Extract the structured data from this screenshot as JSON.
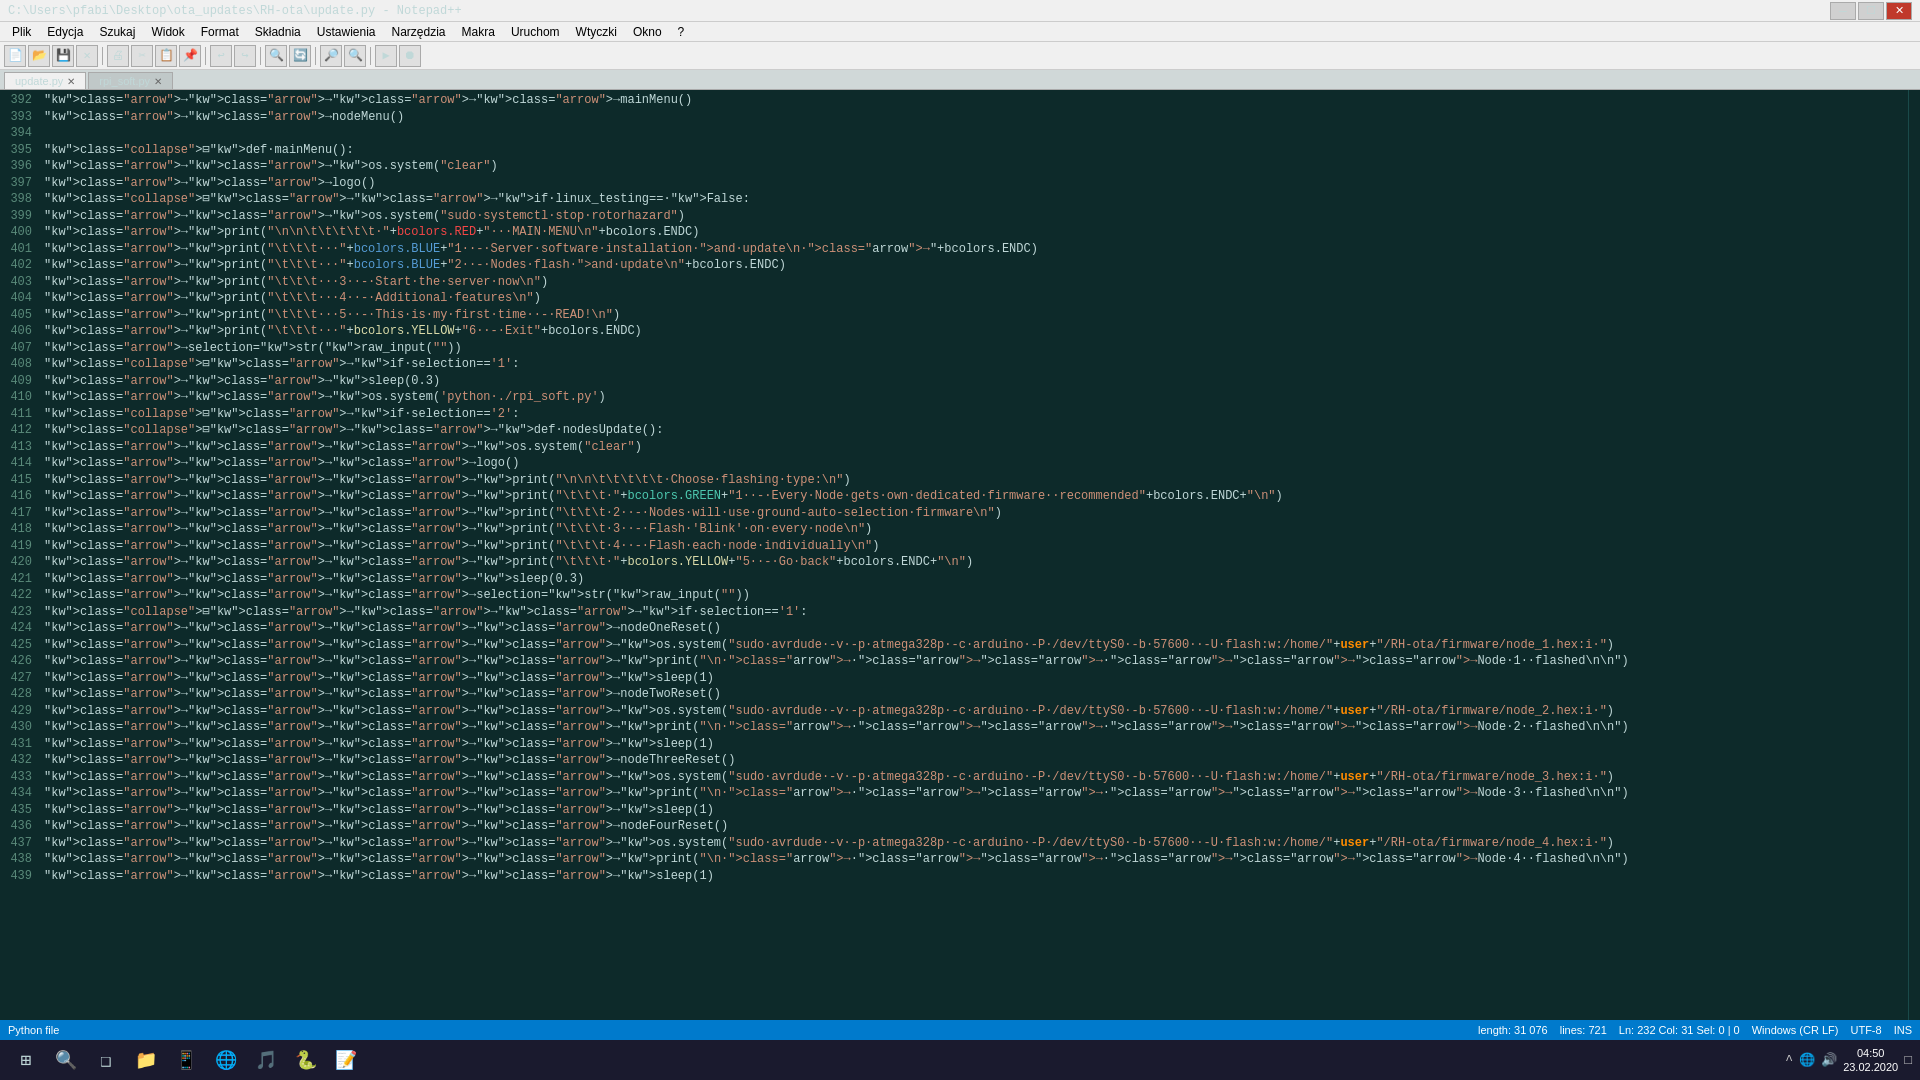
{
  "titleBar": {
    "title": "C:\\Users\\pfabi\\Desktop\\ota_updates\\RH-ota\\update.py - Notepad++",
    "minimize": "─",
    "restore": "☐",
    "close": "✕"
  },
  "menuBar": {
    "items": [
      "Plik",
      "Edycja",
      "Szukaj",
      "Widok",
      "Format",
      "Składnia",
      "Ustawienia",
      "Narzędzia",
      "Makra",
      "Uruchom",
      "Wtyczki",
      "Okno",
      "?"
    ]
  },
  "tabs": [
    {
      "label": "update.py",
      "active": true
    },
    {
      "label": "rpi_soft.py",
      "active": false
    }
  ],
  "statusBar": {
    "filetype": "Python file",
    "length": "length: 31 076",
    "lines": "lines: 721",
    "position": "Ln: 232   Col: 31   Sel: 0 | 0",
    "lineEnding": "Windows (CR LF)",
    "encoding": "UTF-8",
    "insertMode": "INS"
  },
  "taskbar": {
    "clock": "04:50",
    "date": "23.02.2020"
  },
  "code": {
    "startLine": 392,
    "lines": [
      {
        "num": 392,
        "text": "    →→→→mainMenu()"
      },
      {
        "num": 393,
        "text": "    →→nodeMenu()"
      },
      {
        "num": 394,
        "text": ""
      },
      {
        "num": 395,
        "text": "⊟def·mainMenu():"
      },
      {
        "num": 396,
        "text": "    →→os.system(\"clear\")"
      },
      {
        "num": 397,
        "text": "    →→logo()"
      },
      {
        "num": 398,
        "text": "⊟   →→if·linux_testing==·False:"
      },
      {
        "num": 399,
        "text": "        →→os.system(\"sudo·systemctl·stop·rotorhazard\")"
      },
      {
        "num": 400,
        "text": "    →print(\"\\n\\n\\t\\t\\t\\t\\t·\"+bcolors.RED+\"···MAIN·MENU\\n\"+bcolors.ENDC)"
      },
      {
        "num": 401,
        "text": "    →print(\"\\t\\t\\t···\"+bcolors.BLUE+\"1··-·Server·software·installation·and·update\\n·→\"+bcolors.ENDC)"
      },
      {
        "num": 402,
        "text": "    →print(\"\\t\\t\\t···\"+bcolors.BLUE+\"2··-·Nodes·flash·and·update\\n\"+bcolors.ENDC)"
      },
      {
        "num": 403,
        "text": "    →print(\"\\t\\t\\t···3··-·Start·the·server·now\\n\")"
      },
      {
        "num": 404,
        "text": "    →print(\"\\t\\t\\t···4··-·Additional·features\\n\")"
      },
      {
        "num": 405,
        "text": "    →print(\"\\t\\t\\t···5··-·This·is·my·first·time··-·READ!\\n\")"
      },
      {
        "num": 406,
        "text": "    →print(\"\\t\\t\\t···\"+bcolors.YELLOW+\"6··-·Exit\"+bcolors.ENDC)"
      },
      {
        "num": 407,
        "text": "    →selection=str(raw_input(\"\"))"
      },
      {
        "num": 408,
        "text": "⊟   →if·selection=='1':"
      },
      {
        "num": 409,
        "text": "        →→sleep(0.3)"
      },
      {
        "num": 410,
        "text": "        →→os.system('python·./rpi_soft.py')"
      },
      {
        "num": 411,
        "text": "⊟   →if·selection=='2':"
      },
      {
        "num": 412,
        "text": "⊟       →→def·nodesUpdate():"
      },
      {
        "num": 413,
        "text": "            →→→os.system(\"clear\")"
      },
      {
        "num": 414,
        "text": "            →→→logo()"
      },
      {
        "num": 415,
        "text": "            →→→print(\"\\n\\n\\t\\t\\t\\t\\t·Choose·flashing·type:\\n\")"
      },
      {
        "num": 416,
        "text": "            →→→print(\"\\t\\t\\t·\"+bcolors.GREEN+\"1··-·Every·Node·gets·own·dedicated·firmware··recommended\"+bcolors.ENDC+\"\\n\")"
      },
      {
        "num": 417,
        "text": "            →→→print(\"\\t\\t\\t·2··-·Nodes·will·use·ground-auto-selection·firmware\\n\")"
      },
      {
        "num": 418,
        "text": "            →→→print(\"\\t\\t\\t·3··-·Flash·'Blink'·on·every·node\\n\")"
      },
      {
        "num": 419,
        "text": "            →→→print(\"\\t\\t\\t·4··-·Flash·each·node·individually\\n\")"
      },
      {
        "num": 420,
        "text": "            →→→print(\"\\t\\t\\t·\"+bcolors.YELLOW+\"5··-·Go·back\"+bcolors.ENDC+\"\\n\")"
      },
      {
        "num": 421,
        "text": "            →→→sleep(0.3)"
      },
      {
        "num": 422,
        "text": "            →→→selection=str(raw_input(\"\"))"
      },
      {
        "num": 423,
        "text": "⊟           →→→if·selection=='1':"
      },
      {
        "num": 424,
        "text": "                →→→→nodeOneReset()"
      },
      {
        "num": 425,
        "text": "                →→→→os.system(\"sudo·avrdude·-v·-p·atmega328p·-c·arduino·-P·/dev/ttyS0·-b·57600··-U·flash:w:/home/\"+user+\"/RH-ota/firmware/node_1.hex:i·\")"
      },
      {
        "num": 426,
        "text": "                →→→→print(\"\\n·→·→→·→→→Node·1··flashed\\n\\n\")"
      },
      {
        "num": 427,
        "text": "                →→→→sleep(1)"
      },
      {
        "num": 428,
        "text": "                →→→→nodeTwoReset()"
      },
      {
        "num": 429,
        "text": "                →→→→os.system(\"sudo·avrdude·-v·-p·atmega328p·-c·arduino·-P·/dev/ttyS0·-b·57600··-U·flash:w:/home/\"+user+\"/RH-ota/firmware/node_2.hex:i·\")"
      },
      {
        "num": 430,
        "text": "                →→→→print(\"\\n·→·→→·→→→Node·2··flashed\\n\\n\")"
      },
      {
        "num": 431,
        "text": "                →→→→sleep(1)"
      },
      {
        "num": 432,
        "text": "                →→→→nodeThreeReset()"
      },
      {
        "num": 433,
        "text": "                →→→→os.system(\"sudo·avrdude·-v·-p·atmega328p·-c·arduino·-P·/dev/ttyS0·-b·57600··-U·flash:w:/home/\"+user+\"/RH-ota/firmware/node_3.hex:i·\")"
      },
      {
        "num": 434,
        "text": "                →→→→print(\"\\n·→·→→·→→→Node·3··flashed\\n\\n\")"
      },
      {
        "num": 435,
        "text": "                →→→→sleep(1)"
      },
      {
        "num": 436,
        "text": "                →→→→nodeFourReset()"
      },
      {
        "num": 437,
        "text": "                →→→→os.system(\"sudo·avrdude·-v·-p·atmega328p·-c·arduino·-P·/dev/ttyS0·-b·57600··-U·flash:w:/home/\"+user+\"/RH-ota/firmware/node_4.hex:i·\")"
      },
      {
        "num": 438,
        "text": "                →→→→print(\"\\n·→·→→·→→→Node·4··flashed\\n\\n\")"
      },
      {
        "num": 439,
        "text": "                →→→→sleep(1)"
      }
    ]
  }
}
